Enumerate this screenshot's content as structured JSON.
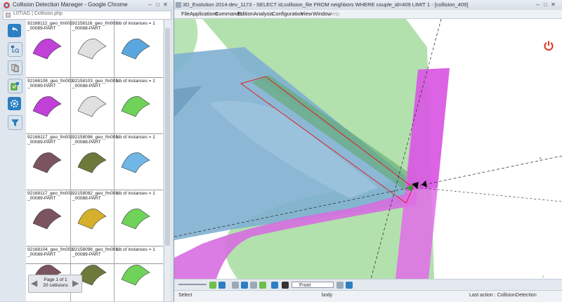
{
  "left_window": {
    "title": "Collision Detection Manager - Google Chrome",
    "url": "L0TIAG | Collision.php",
    "sidebar_icons": [
      "back-icon",
      "tree-search-icon",
      "copy-icon",
      "add-check-icon",
      "settings-icon",
      "filter-icon"
    ],
    "rows": [
      {
        "name_part": "92168112_geo_fm001\n_00089-PART",
        "name_other": "92158116_geo_fm001\n_00088-PART",
        "instances": "Nb of instances = 1"
      },
      {
        "name_part": "92168108_geo_fm001\n_00089-PART",
        "name_other": "92158103_geo_fm001\n_00088-PART",
        "instances": "Nb of instances = 1"
      },
      {
        "name_part": "92168117_geo_fm001\n_00089-PART",
        "name_other": "92158096_geo_fm001\n_00088-PART",
        "instances": "Nb of instances = 1"
      },
      {
        "name_part": "92168117_geo_fm001\n_00089-PART",
        "name_other": "92158082_geo_fm001\n_00088-PART",
        "instances": "Nb of instances = 1"
      },
      {
        "name_part": "92168104_geo_fm001\n_00089-PART",
        "name_other": "92158096_geo_fm001\n_00089-PART",
        "instances": "Nb of instances = 1"
      },
      {
        "name_part": "",
        "name_other": "",
        "instances": ""
      }
    ],
    "pager": {
      "page": "Page 1 of 1",
      "count": "20 collisions"
    }
  },
  "right_window": {
    "title": "3D_Evolution 2014-dev_1173 - SELECT id,collision_file FROM neighbors WHERE couple_id=409 LIMIT 1 - [collision_409]",
    "menu": [
      "File",
      "Applications",
      "Commands",
      "Edition",
      "Analysis",
      "Configuration",
      "View",
      "Window",
      "Help"
    ],
    "view_select": "Front",
    "status": {
      "left": "Select",
      "mid": "body",
      "right": "Last action : CollisionDetection"
    },
    "colors": {
      "green": "#a6dca0",
      "blue": "#7fb0d2",
      "magenta": "#e06de8",
      "red_outline": "#e02020",
      "power": "#e0301e"
    }
  }
}
